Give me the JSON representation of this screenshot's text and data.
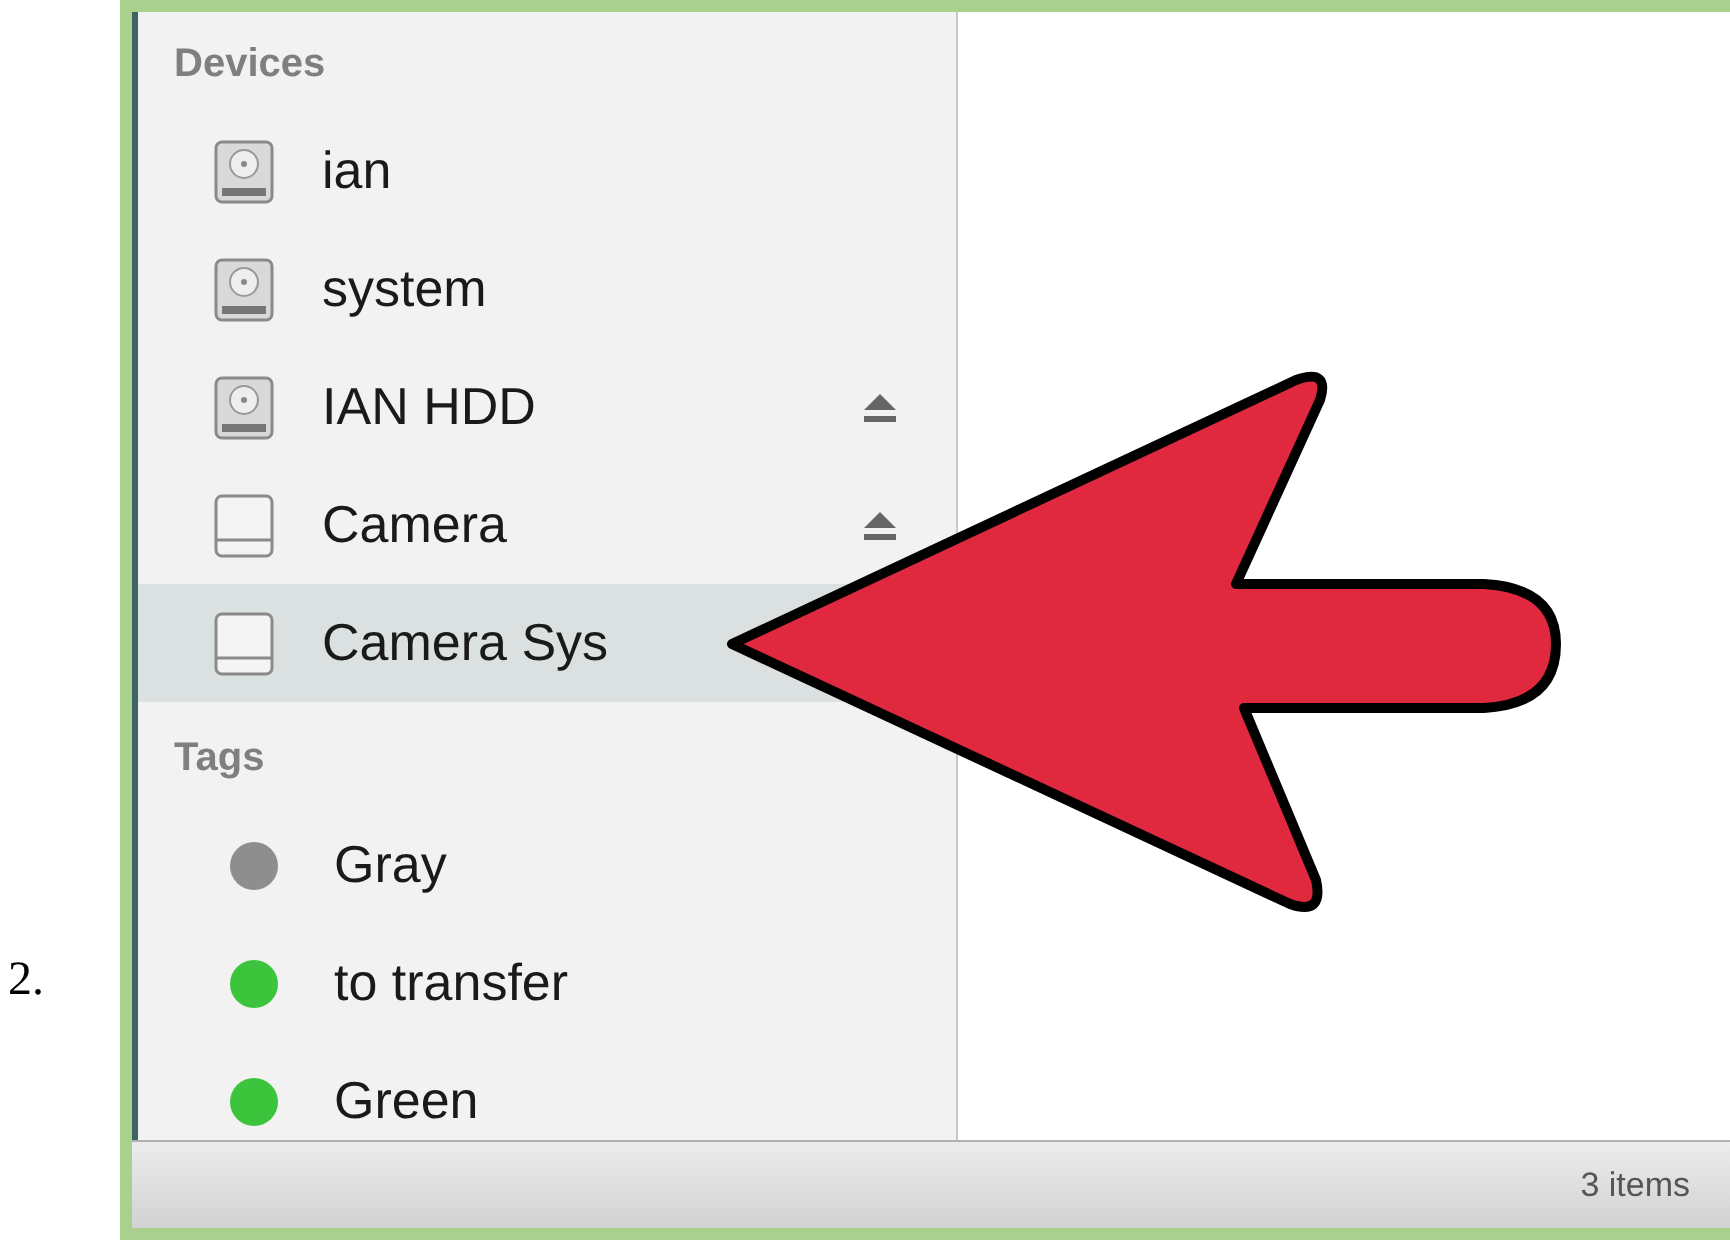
{
  "page_label": "2.",
  "sidebar": {
    "sections": [
      {
        "kind": "devices",
        "title": "Devices",
        "items": [
          {
            "label": "ian",
            "selected": false,
            "eject": false,
            "kind": "hdd"
          },
          {
            "label": "system",
            "selected": false,
            "eject": false,
            "kind": "hdd"
          },
          {
            "label": "IAN HDD",
            "selected": false,
            "eject": true,
            "kind": "hdd"
          },
          {
            "label": "Camera",
            "selected": false,
            "eject": true,
            "kind": "external"
          },
          {
            "label": "Camera Sys",
            "selected": true,
            "eject": false,
            "kind": "external"
          }
        ]
      },
      {
        "kind": "tags",
        "title": "Tags",
        "items": [
          {
            "label": "Gray",
            "color": "#8e8e8e"
          },
          {
            "label": "to transfer",
            "color": "#3cc43c"
          },
          {
            "label": "Green",
            "color": "#3cc43c"
          }
        ]
      }
    ]
  },
  "status_bar": "3 items"
}
